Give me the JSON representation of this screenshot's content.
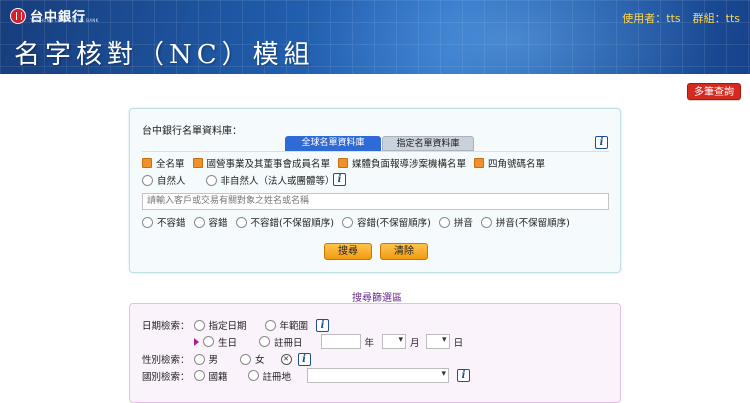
{
  "header": {
    "logo_text": "台中銀行",
    "logo_sub": "TAICHUNG COMMERCIAL BANK",
    "title": "名字核對（NC）模組",
    "user_label": "使用者：tts",
    "group_label": "群組：tts"
  },
  "multi_query_label": "多筆查詢",
  "search_panel": {
    "library_label": "台中銀行名單資料庫：",
    "tabs": [
      "全球名單資料庫",
      "指定名單資料庫"
    ],
    "lists": [
      "全名單",
      "國營事業及其董事會成員名單",
      "媒體負面報導涉案機構名單",
      "四角號碼名單"
    ],
    "person_types": [
      "自然人",
      "非自然人（法人或團體等）"
    ],
    "search_placeholder": "請輸入客戶或交易有關對象之姓名或名稱",
    "match_modes": [
      "不容錯",
      "容錯",
      "不容錯(不保留順序)",
      "容錯(不保留順序)",
      "拼音",
      "拼音(不保留順序)"
    ],
    "search_button": "搜尋",
    "clear_button": "清除"
  },
  "filter": {
    "section_title": "搜尋篩選區",
    "date_label": "日期檢索：",
    "date_options": [
      "指定日期",
      "年範圍"
    ],
    "date_sub_options": [
      "生日",
      "註冊日"
    ],
    "year_unit": "年",
    "month_unit": "月",
    "day_unit": "日",
    "gender_label": "性別檢索：",
    "gender_options": [
      "男",
      "女"
    ],
    "country_label": "國別檢索：",
    "country_options": [
      "國籍",
      "註冊地"
    ]
  },
  "colors": {
    "header_blue": "#1f5aa8",
    "user_yellow": "#ffd74a",
    "multi_btn_red": "#d42a20",
    "tab_active": "#2f6bd6",
    "checkbox_orange": "#f0912a",
    "button_orange": "#f19b12",
    "filter_title_purple": "#6a2a8a"
  },
  "icons": [
    "info-icon",
    "logo-icon",
    "dropdown-arrow-icon",
    "marker-triangle-icon"
  ]
}
